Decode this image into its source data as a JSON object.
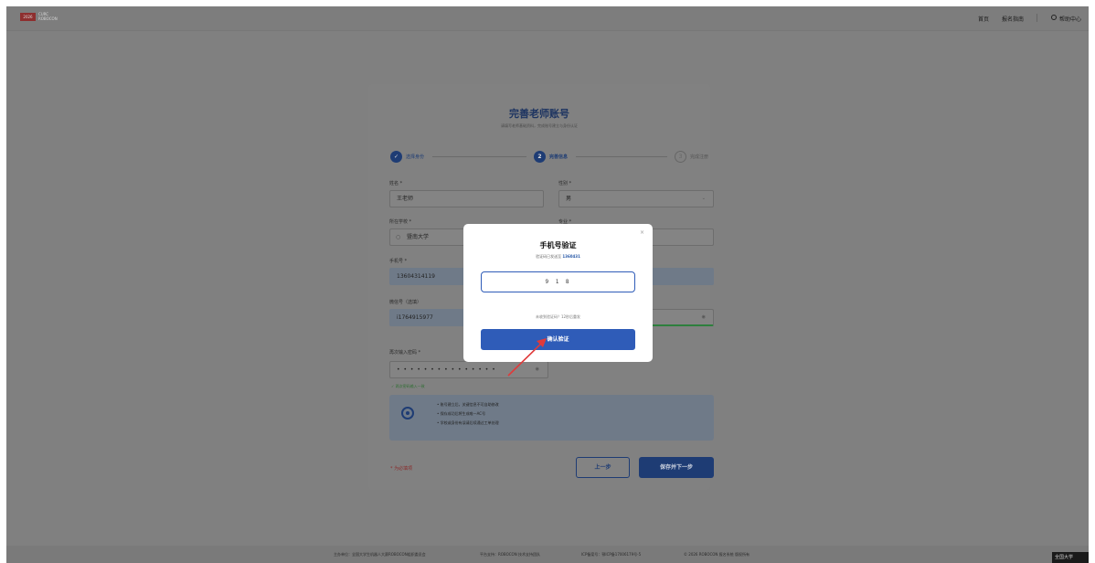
{
  "header": {
    "logo_mark": "2026",
    "logo_line1": "CURC",
    "logo_line2": "ROBOCON",
    "nav_home": "首页",
    "nav_guide": "报名指南",
    "nav_help": "帮助中心"
  },
  "card": {
    "title": "完善老师账号",
    "subtitle": "请填写老师基础资料，完成账号建立与身份认证",
    "steps": [
      {
        "num": "✓",
        "label": "选择身份"
      },
      {
        "num": "2",
        "label": "完善信息"
      },
      {
        "num": "3",
        "label": "完成注册"
      }
    ],
    "fields": {
      "name_label": "姓名 *",
      "name_value": "王老师",
      "gender_label": "性别 *",
      "gender_value": "男",
      "school_label": "所在学校 *",
      "school_value": "暨南大学",
      "dept_label": "专业 *",
      "phone_label": "手机号 *",
      "phone_value": "13604314119",
      "wechat_label": "微信号（选填）",
      "wechat_value": "i1764915977",
      "confirm_pwd_label": "再次输入密码 *",
      "confirm_pwd_value": "• • • • • • • • • • • • • • •",
      "pwd_match_hint": "✓ 两次密码输入一致"
    },
    "info": [
      "• 账号建立后，关键信息不可自助修改",
      "• 保存成功后将生成唯一AC号",
      "• 学校或身份有误请后续通过工单处理"
    ],
    "required_note": "* 为必填项",
    "prev_button": "上一步",
    "next_button": "保存并下一步"
  },
  "modal": {
    "close": "×",
    "title": "手机号验证",
    "sent_to_prefix": "验证码已发送至",
    "sent_to_number": "1360431",
    "code_value": "9 1 8",
    "resend_text": "未收到验证码？12秒后重发",
    "confirm_button": "确认验证"
  },
  "footer": {
    "host": "主办单位：全国大学生机器人大赛ROBOCON组织委员会",
    "support": "平台支持：ROBOCON 技术支持团队",
    "icp": "ICP备案号：鄂ICP备17006179号-5",
    "copyright": "© 2026 ROBOCON 报名系统 版权所有",
    "badge": "全国大学"
  },
  "colors": {
    "brand_blue": "#2f5cb8",
    "navy": "#1e3c74",
    "overlay_gray": "#808080",
    "arrow_red": "#e03a3a"
  }
}
